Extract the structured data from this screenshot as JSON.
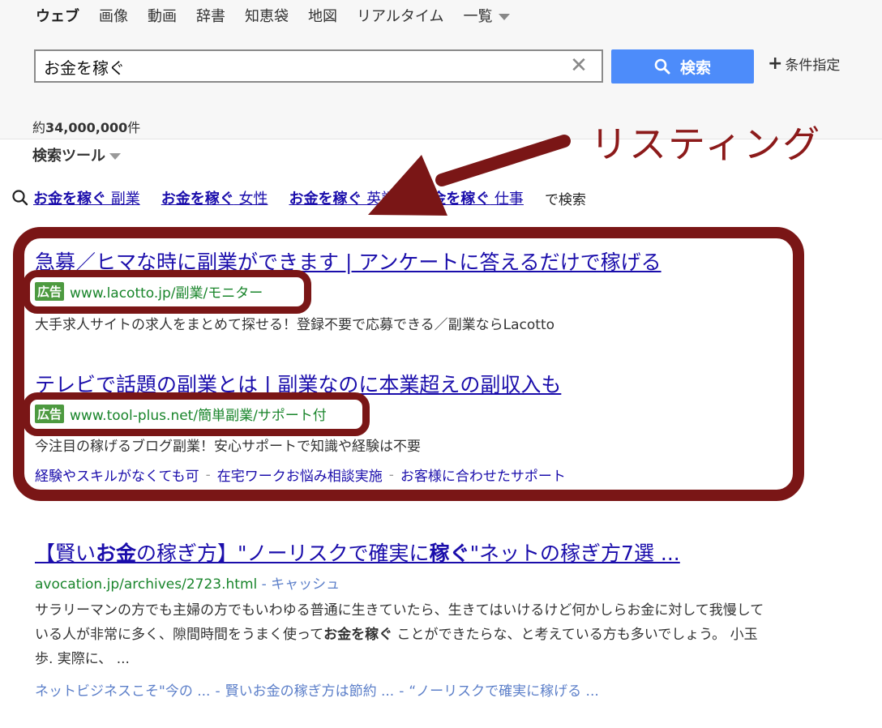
{
  "nav": {
    "tabs": [
      "ウェブ",
      "画像",
      "動画",
      "辞書",
      "知恵袋",
      "地図",
      "リアルタイム"
    ],
    "more": "一覧"
  },
  "search": {
    "query": "お金を稼ぐ",
    "clear": "✕",
    "button_label": "検索",
    "conditions_label": "条件指定"
  },
  "results_count": {
    "prefix": "約",
    "number": "34,000,000",
    "suffix": "件"
  },
  "search_tools": "検索ツール",
  "related": {
    "items": [
      {
        "bold": "お金を稼ぐ",
        "rest": " 副業"
      },
      {
        "bold": "お金を稼ぐ",
        "rest": " 女性"
      },
      {
        "bold": "お金を稼ぐ",
        "rest": " 英語"
      },
      {
        "bold": "お金を稼ぐ",
        "rest": " 仕事"
      }
    ],
    "suffix": "で検索"
  },
  "annotation": "リスティング",
  "ads": [
    {
      "title": "急募／ヒマな時に副業ができます | アンケートに答えるだけで稼げる",
      "badge": "広告",
      "url": "www.lacotto.jp/副業/モニター",
      "description": "大手求人サイトの求人をまとめて探せる！登録不要で応募できる／副業ならLacotto"
    },
    {
      "title": "テレビで話題の副業とは | 副業なのに本業超えの副収入も",
      "badge": "広告",
      "url": "www.tool-plus.net/簡単副業/サポート付",
      "description": "今注目の稼げるブログ副業！安心サポートで知識や経験は不要",
      "sitelinks": [
        "経験やスキルがなくても可",
        "在宅ワークお悩み相談実施",
        "お客様に合わせたサポート"
      ]
    }
  ],
  "organic": {
    "title_parts": [
      {
        "t": "【賢い",
        "b": false
      },
      {
        "t": "お金",
        "b": true
      },
      {
        "t": "の稼ぎ方】\"ノーリスクで確実に",
        "b": false
      },
      {
        "t": "稼ぐ",
        "b": true
      },
      {
        "t": "\"ネットの稼ぎ方7選 ...",
        "b": false
      }
    ],
    "url": "avocation.jp/archives/2723.html",
    "cache": " - キャッシュ",
    "snippet_parts": [
      {
        "t": "サラリーマンの方でも主婦の方でもいわゆる普通に生きていたら、生きてはいけるけど何かしらお金に対して我慢している人が非常に多く、隙間時間をうまく使って",
        "b": false
      },
      {
        "t": "お金を稼ぐ",
        "b": true
      },
      {
        "t": " ことができたらな、と考えている方も多いでしょう。 小玉歩. 実際に、 ...",
        "b": false
      }
    ],
    "links": [
      "ネットビジネスこそ\"今の ...",
      "賢いお金の稼ぎ方は節約 ...",
      "“ノーリスクで確実に稼げる ..."
    ]
  }
}
